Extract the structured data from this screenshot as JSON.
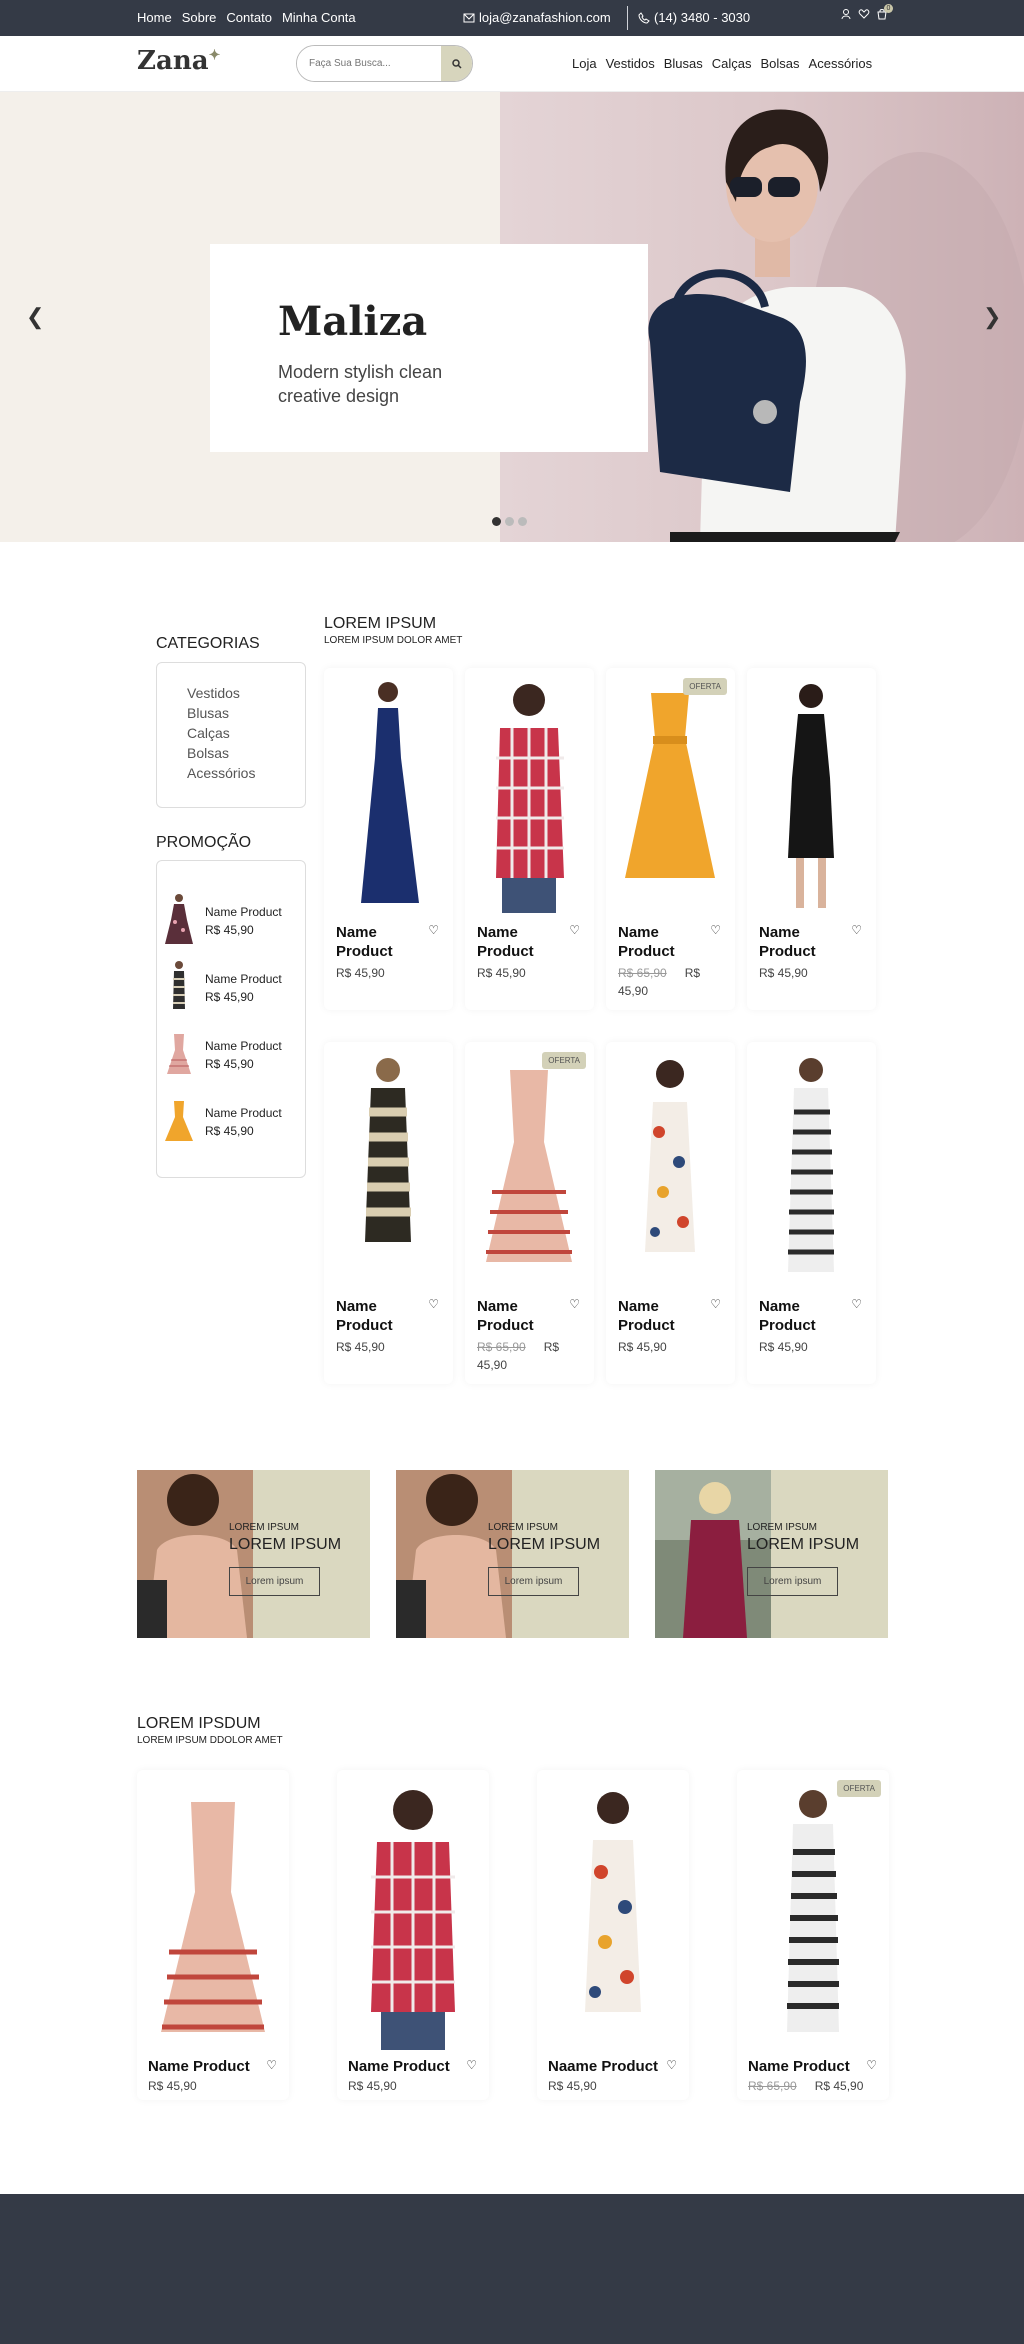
{
  "topbar": {
    "links": [
      "Home",
      "Sobre",
      "Contato",
      "Minha Conta"
    ],
    "email": "loja@zanafashion.com",
    "phone": "(14) 3480 - 3030",
    "cart_count": "0"
  },
  "header": {
    "logo": "Zana",
    "search_placeholder": "Faça Sua Busca...",
    "nav": [
      "Loja",
      "Vestidos",
      "Blusas",
      "Calças",
      "Bolsas",
      "Acessórios"
    ]
  },
  "hero": {
    "title": "Maliza",
    "subtitle": "Modern stylish clean creative design"
  },
  "sidebar": {
    "categories_title": "CATEGORIAS",
    "categories": [
      "Vestidos",
      "Blusas",
      "Calças",
      "Bolsas",
      "Acessórios"
    ],
    "promo_title": "PROMOÇÃO",
    "promo_items": [
      {
        "name": "Name Product",
        "price": "R$ 45,90"
      },
      {
        "name": "Name Product",
        "price": "R$ 45,90"
      },
      {
        "name": "Name Product",
        "price": "R$ 45,90"
      },
      {
        "name": "Name Product",
        "price": "R$ 45,90"
      }
    ]
  },
  "products": {
    "title": "LOREM IPSUM",
    "subtitle": "LOREM IPSUM DOLOR AMET",
    "offer_label": "OFERTA",
    "items": [
      {
        "name": "Name Product",
        "price": "R$ 45,90",
        "old": ""
      },
      {
        "name": "Name Product",
        "price": "R$ 45,90",
        "old": ""
      },
      {
        "name": "Name Product",
        "price": "R$ 45,90",
        "old": "R$ 65,90"
      },
      {
        "name": "Name Product",
        "price": "R$ 45,90",
        "old": ""
      },
      {
        "name": "Name Product",
        "price": "R$ 45,90",
        "old": ""
      },
      {
        "name": "Name Product",
        "price": "R$ 45,90",
        "old": "R$ 65,90"
      },
      {
        "name": "Name Product",
        "price": "R$ 45,90",
        "old": ""
      },
      {
        "name": "Name Product",
        "price": "R$ 45,90",
        "old": ""
      }
    ]
  },
  "banners": [
    {
      "small": "LOREM IPSUM",
      "big": "LOREM IPSUM",
      "button": "Lorem ipsum"
    },
    {
      "small": "LOREM IPSUM",
      "big": "LOREM IPSUM",
      "button": "Lorem ipsum"
    },
    {
      "small": "LOREM IPSUM",
      "big": "LOREM IPSUM",
      "button": "Lorem ipsum"
    }
  ],
  "second": {
    "title": "LOREM IPSDUM",
    "subtitle": "LOREM IPSUM DDOLOR AMET",
    "items": [
      {
        "name": "Name Product",
        "price": "R$ 45,90",
        "old": ""
      },
      {
        "name": "Name Product",
        "price": "R$ 45,90",
        "old": ""
      },
      {
        "name": "Naame Product",
        "price": "R$ 45,90",
        "old": ""
      },
      {
        "name": "Name Product",
        "price": "R$ 45,90",
        "old": "R$ 65,90"
      }
    ]
  },
  "colors": {
    "dark": "#343a46",
    "accent": "#d7d5bd",
    "hero_bg": "#f4f0ea"
  }
}
